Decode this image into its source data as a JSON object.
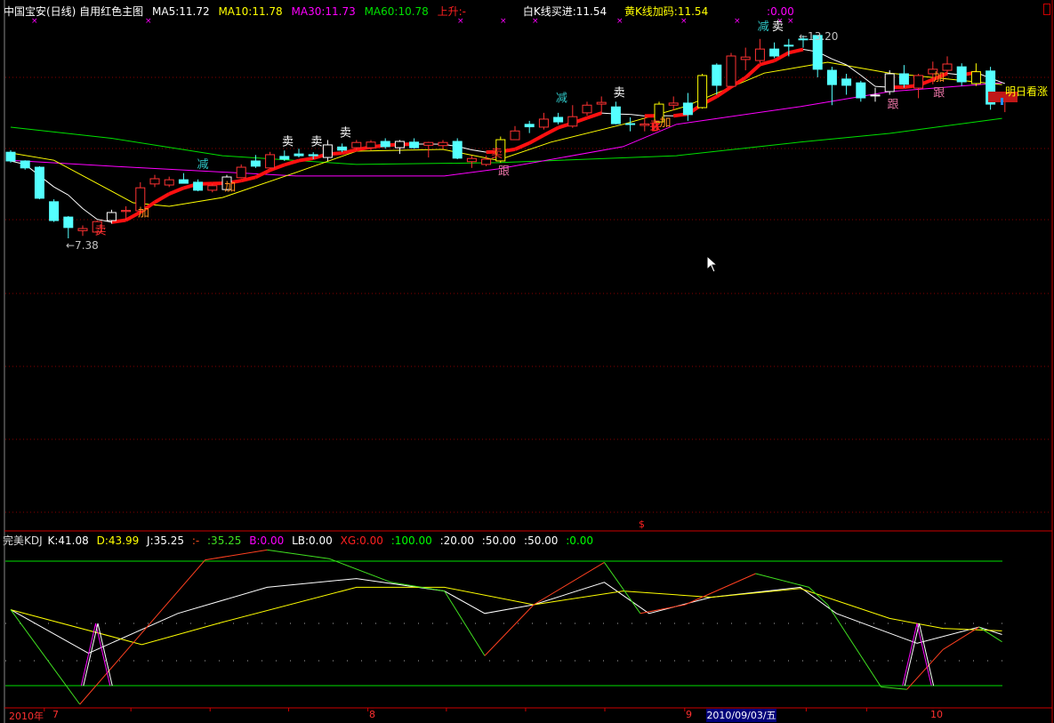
{
  "header": {
    "title": "中国宝安(日线) 自用红色主图",
    "ma5": "MA5:11.72",
    "ma10": "MA10:11.78",
    "ma30": "MA30:11.73",
    "ma60": "MA60:10.78",
    "trend": "上升:-",
    "white_buy": "白K线买进:11.54",
    "yellow_add": "黄K线加码:11.54",
    "extra": ":0.00"
  },
  "kdj_header": {
    "title": "完美KDJ",
    "k": "K:41.08",
    "d": "D:43.99",
    "j": "J:35.25",
    "dash": ":-",
    "v1": ":35.25",
    "b": "B:0.00",
    "lb": "LB:0.00",
    "xg": "XG:0.00",
    "l100": ":100.00",
    "l20": ":20.00",
    "l50a": ":50.00",
    "l50b": ":50.00",
    "l0": ":0.00"
  },
  "axis": {
    "year": "2010年",
    "m7": "7",
    "m8": "8",
    "m9": "9",
    "m10": "10",
    "cursor_date": "2010/09/03/五",
    "divider_mark": "$"
  },
  "colors": {
    "up": "#ff3232",
    "down": "#54ffff",
    "white": "#ffffff",
    "yellow": "#ffff00",
    "ma5": "#ffffff",
    "ma10": "#ffff00",
    "ma30": "#ff00ff",
    "ma60": "#00e000",
    "bg": "#000000"
  },
  "chart_data": [
    {
      "type": "candlestick",
      "title": "中国宝安(日线)",
      "ylim": [
        7.0,
        13.6
      ],
      "low_label": "←7.38",
      "high_label": "←13.20",
      "forecast_label": "明日看涨",
      "candles": [
        {
          "o": 9.85,
          "h": 9.91,
          "l": 9.55,
          "c": 9.6,
          "k": "c"
        },
        {
          "o": 9.6,
          "h": 9.62,
          "l": 9.35,
          "c": 9.4,
          "k": "c"
        },
        {
          "o": 9.42,
          "h": 9.45,
          "l": 8.5,
          "c": 8.53,
          "k": "c"
        },
        {
          "o": 8.43,
          "h": 8.5,
          "l": 7.85,
          "c": 7.89,
          "k": "c"
        },
        {
          "o": 7.99,
          "h": 8.02,
          "l": 7.38,
          "c": 7.69,
          "k": "c"
        },
        {
          "o": 7.6,
          "h": 7.75,
          "l": 7.45,
          "c": 7.66,
          "k": "r"
        },
        {
          "o": 7.56,
          "h": 7.9,
          "l": 7.5,
          "c": 7.86,
          "k": "r"
        },
        {
          "o": 7.89,
          "h": 8.2,
          "l": 7.8,
          "c": 8.12,
          "k": "w"
        },
        {
          "o": 8.15,
          "h": 8.3,
          "l": 7.9,
          "c": 8.18,
          "k": "r"
        },
        {
          "o": 8.17,
          "h": 8.99,
          "l": 8.15,
          "c": 8.83,
          "k": "r"
        },
        {
          "o": 8.94,
          "h": 9.2,
          "l": 8.85,
          "c": 9.09,
          "k": "r"
        },
        {
          "o": 8.91,
          "h": 9.15,
          "l": 8.85,
          "c": 9.06,
          "k": "r"
        },
        {
          "o": 9.06,
          "h": 9.25,
          "l": 8.95,
          "c": 8.96,
          "k": "c"
        },
        {
          "o": 8.99,
          "h": 9.07,
          "l": 8.73,
          "c": 8.76,
          "k": "c"
        },
        {
          "o": 8.76,
          "h": 8.95,
          "l": 8.7,
          "c": 8.89,
          "k": "r"
        },
        {
          "o": 8.78,
          "h": 9.2,
          "l": 8.75,
          "c": 9.14,
          "k": "w"
        },
        {
          "o": 9.12,
          "h": 9.5,
          "l": 9.1,
          "c": 9.42,
          "k": "r"
        },
        {
          "o": 9.6,
          "h": 9.77,
          "l": 9.4,
          "c": 9.45,
          "k": "c"
        },
        {
          "o": 9.4,
          "h": 9.86,
          "l": 9.38,
          "c": 9.78,
          "k": "r"
        },
        {
          "o": 9.73,
          "h": 9.9,
          "l": 9.6,
          "c": 9.65,
          "k": "c"
        },
        {
          "o": 9.8,
          "h": 9.95,
          "l": 9.7,
          "c": 9.75,
          "k": "c"
        },
        {
          "o": 9.78,
          "h": 9.85,
          "l": 9.65,
          "c": 9.75,
          "k": "c"
        },
        {
          "o": 9.7,
          "h": 10.2,
          "l": 9.6,
          "c": 10.06,
          "k": "w"
        },
        {
          "o": 10.0,
          "h": 10.1,
          "l": 9.85,
          "c": 9.91,
          "k": "c"
        },
        {
          "o": 9.98,
          "h": 10.2,
          "l": 9.9,
          "c": 10.13,
          "k": "r"
        },
        {
          "o": 9.98,
          "h": 10.2,
          "l": 9.9,
          "c": 10.14,
          "k": "r"
        },
        {
          "o": 10.16,
          "h": 10.25,
          "l": 9.95,
          "c": 10.01,
          "k": "c"
        },
        {
          "o": 9.98,
          "h": 10.2,
          "l": 9.8,
          "c": 10.16,
          "k": "w"
        },
        {
          "o": 10.14,
          "h": 10.25,
          "l": 9.95,
          "c": 9.98,
          "k": "c"
        },
        {
          "o": 10.05,
          "h": 10.15,
          "l": 9.7,
          "c": 10.13,
          "k": "r"
        },
        {
          "o": 10.04,
          "h": 10.2,
          "l": 9.95,
          "c": 10.13,
          "k": "r"
        },
        {
          "o": 10.16,
          "h": 10.25,
          "l": 9.65,
          "c": 9.68,
          "k": "c"
        },
        {
          "o": 9.58,
          "h": 9.75,
          "l": 9.4,
          "c": 9.67,
          "k": "r"
        },
        {
          "o": 9.5,
          "h": 9.75,
          "l": 9.45,
          "c": 9.65,
          "k": "r"
        },
        {
          "o": 9.6,
          "h": 10.3,
          "l": 9.55,
          "c": 10.21,
          "k": "y"
        },
        {
          "o": 10.21,
          "h": 10.6,
          "l": 10.2,
          "c": 10.46,
          "k": "r"
        },
        {
          "o": 10.65,
          "h": 10.75,
          "l": 10.4,
          "c": 10.58,
          "k": "c"
        },
        {
          "o": 10.57,
          "h": 10.98,
          "l": 10.5,
          "c": 10.8,
          "k": "r"
        },
        {
          "o": 10.85,
          "h": 10.98,
          "l": 10.65,
          "c": 10.72,
          "k": "c"
        },
        {
          "o": 10.6,
          "h": 11.2,
          "l": 10.55,
          "c": 10.87,
          "k": "r"
        },
        {
          "o": 10.98,
          "h": 11.3,
          "l": 10.9,
          "c": 11.2,
          "k": "r"
        },
        {
          "o": 11.23,
          "h": 11.45,
          "l": 10.95,
          "c": 11.28,
          "k": "r"
        },
        {
          "o": 11.15,
          "h": 11.3,
          "l": 10.65,
          "c": 10.67,
          "k": "c"
        },
        {
          "o": 10.67,
          "h": 10.85,
          "l": 10.45,
          "c": 10.65,
          "k": "c"
        },
        {
          "o": 10.62,
          "h": 10.85,
          "l": 10.45,
          "c": 10.66,
          "k": "r"
        },
        {
          "o": 10.72,
          "h": 11.3,
          "l": 10.7,
          "c": 11.23,
          "k": "y"
        },
        {
          "o": 11.2,
          "h": 11.45,
          "l": 11.05,
          "c": 11.26,
          "k": "r"
        },
        {
          "o": 11.26,
          "h": 11.55,
          "l": 10.75,
          "c": 10.93,
          "k": "c"
        },
        {
          "o": 11.13,
          "h": 12.1,
          "l": 11.1,
          "c": 12.05,
          "k": "y"
        },
        {
          "o": 12.35,
          "h": 12.4,
          "l": 11.5,
          "c": 11.77,
          "k": "c"
        },
        {
          "o": 11.74,
          "h": 12.7,
          "l": 11.7,
          "c": 12.61,
          "k": "r"
        },
        {
          "o": 12.51,
          "h": 12.85,
          "l": 12.2,
          "c": 12.58,
          "k": "r"
        },
        {
          "o": 12.48,
          "h": 13.1,
          "l": 12.4,
          "c": 12.81,
          "k": "r"
        },
        {
          "o": 12.81,
          "h": 13.0,
          "l": 12.55,
          "c": 12.61,
          "k": "c"
        },
        {
          "o": 12.92,
          "h": 13.1,
          "l": 12.6,
          "c": 12.91,
          "k": "c"
        },
        {
          "o": 13.1,
          "h": 13.2,
          "l": 12.85,
          "c": 13.09,
          "k": "c"
        },
        {
          "o": 13.2,
          "h": 13.2,
          "l": 12.0,
          "c": 12.23,
          "k": "c"
        },
        {
          "o": 12.2,
          "h": 12.3,
          "l": 11.2,
          "c": 11.79,
          "k": "c"
        },
        {
          "o": 11.95,
          "h": 12.1,
          "l": 11.5,
          "c": 11.77,
          "k": "c"
        },
        {
          "o": 11.84,
          "h": 11.9,
          "l": 11.3,
          "c": 11.41,
          "k": "c"
        },
        {
          "o": 11.48,
          "h": 11.7,
          "l": 11.3,
          "c": 11.49,
          "k": "w"
        },
        {
          "o": 11.59,
          "h": 12.2,
          "l": 11.5,
          "c": 12.1,
          "k": "w"
        },
        {
          "o": 12.1,
          "h": 12.35,
          "l": 11.7,
          "c": 11.8,
          "k": "c"
        },
        {
          "o": 11.69,
          "h": 12.1,
          "l": 11.4,
          "c": 12.05,
          "k": "r"
        },
        {
          "o": 12.1,
          "h": 12.45,
          "l": 11.8,
          "c": 12.23,
          "k": "r"
        },
        {
          "o": 12.2,
          "h": 12.6,
          "l": 12.05,
          "c": 12.38,
          "k": "r"
        },
        {
          "o": 12.3,
          "h": 12.4,
          "l": 11.75,
          "c": 11.87,
          "k": "c"
        },
        {
          "o": 11.82,
          "h": 12.4,
          "l": 11.75,
          "c": 12.16,
          "k": "y"
        },
        {
          "o": 12.18,
          "h": 12.3,
          "l": 11.07,
          "c": 11.23,
          "k": "c"
        },
        {
          "o": 11.3,
          "h": 11.5,
          "l": 11.0,
          "c": 11.46,
          "k": "r"
        }
      ],
      "ma10_points": [
        [
          0,
          9.83
        ],
        [
          3,
          9.62
        ],
        [
          8.5,
          8.4
        ],
        [
          11,
          8.3
        ],
        [
          14.7,
          8.55
        ],
        [
          19.6,
          9.24
        ],
        [
          24,
          9.88
        ],
        [
          30,
          9.93
        ],
        [
          33.8,
          9.62
        ],
        [
          37.5,
          10.14
        ],
        [
          42.5,
          10.65
        ],
        [
          46.8,
          11.16
        ],
        [
          52.3,
          12.12
        ],
        [
          56.7,
          12.43
        ],
        [
          61,
          12.12
        ],
        [
          68.8,
          11.79
        ]
      ],
      "ma30_points": [
        [
          0,
          9.62
        ],
        [
          7,
          9.45
        ],
        [
          19.8,
          9.17
        ],
        [
          30.1,
          9.17
        ],
        [
          33.8,
          9.37
        ],
        [
          42.5,
          10.01
        ],
        [
          46.2,
          10.65
        ],
        [
          54.8,
          11.16
        ],
        [
          61,
          11.59
        ],
        [
          68.8,
          11.84
        ]
      ],
      "ma60_points": [
        [
          0,
          10.57
        ],
        [
          7,
          10.25
        ],
        [
          14.7,
          9.75
        ],
        [
          24,
          9.5
        ],
        [
          33.8,
          9.55
        ],
        [
          46.2,
          9.75
        ],
        [
          54.8,
          10.14
        ],
        [
          61,
          10.39
        ],
        [
          68.8,
          10.82
        ]
      ],
      "annotations": [
        {
          "text": "卖",
          "i": 19.2,
          "p": 10.05,
          "color": "#ffffff"
        },
        {
          "text": "卖",
          "i": 21.2,
          "p": 10.05,
          "color": "#ffffff"
        },
        {
          "text": "卖",
          "i": 23.2,
          "p": 10.3,
          "color": "#ffffff"
        },
        {
          "text": "卖",
          "i": 42.2,
          "p": 11.45,
          "color": "#ffffff"
        },
        {
          "text": "卖",
          "i": 53.2,
          "p": 13.35,
          "color": "#ffffff"
        },
        {
          "text": "减",
          "i": 13.3,
          "p": 9.4,
          "color": "#30c8c8"
        },
        {
          "text": "减",
          "i": 38.2,
          "p": 11.3,
          "color": "#30c8c8"
        },
        {
          "text": "减",
          "i": 52.2,
          "p": 13.35,
          "color": "#30c8c8"
        },
        {
          "text": "加",
          "i": 9.2,
          "p": 8.0,
          "color": "#ff9020"
        },
        {
          "text": "加",
          "i": 15.2,
          "p": 8.75,
          "color": "#ff9020"
        },
        {
          "text": "加",
          "i": 45.4,
          "p": 10.6,
          "color": "#ff9020"
        },
        {
          "text": "加",
          "i": 64.4,
          "p": 11.9,
          "color": "#ff9020"
        },
        {
          "text": "卖",
          "i": 6.2,
          "p": 7.5,
          "color": "#ff3030"
        },
        {
          "text": "卖",
          "i": 33.7,
          "p": 9.7,
          "color": "#ff3030"
        },
        {
          "text": "卖",
          "i": 44.7,
          "p": 10.5,
          "color": "#ff3030"
        },
        {
          "text": "跟",
          "i": 34.2,
          "p": 9.2,
          "color": "#e070a0"
        },
        {
          "text": "跟",
          "i": 61.2,
          "p": 11.12,
          "color": "#e070a0"
        },
        {
          "text": "跟",
          "i": 64.4,
          "p": 11.45,
          "color": "#e070a0"
        },
        {
          "text": "B",
          "i": 44.8,
          "p": 10.45,
          "color": "#ff2020"
        }
      ]
    },
    {
      "type": "line",
      "title": "完美KDJ",
      "ylim": [
        -20,
        120
      ],
      "reference_lines": [
        100,
        50,
        20,
        0
      ],
      "series": [
        {
          "name": "K",
          "color": "#ffffff",
          "points": [
            [
              0,
              61
            ],
            [
              5.4,
              26
            ],
            [
              11.6,
              58
            ],
            [
              17.8,
              79
            ],
            [
              24,
              86
            ],
            [
              30.1,
              76
            ],
            [
              32.9,
              58
            ],
            [
              36.3,
              65
            ],
            [
              41.2,
              83
            ],
            [
              44.3,
              58
            ],
            [
              48.6,
              71
            ],
            [
              54.8,
              79
            ],
            [
              57.3,
              58
            ],
            [
              62.9,
              34
            ],
            [
              67.2,
              47
            ],
            [
              68.8,
              41.08
            ]
          ]
        },
        {
          "name": "D",
          "color": "#ffff00",
          "points": [
            [
              0,
              61
            ],
            [
              9.1,
              33
            ],
            [
              14.7,
              51
            ],
            [
              24,
              79
            ],
            [
              30.1,
              79
            ],
            [
              36.3,
              65
            ],
            [
              42.5,
              76
            ],
            [
              48.6,
              71
            ],
            [
              54.8,
              78
            ],
            [
              61,
              54
            ],
            [
              64.7,
              46
            ],
            [
              68.8,
              43.99
            ]
          ]
        },
        {
          "name": "J",
          "color": "#40e020",
          "points": [
            [
              0,
              61
            ],
            [
              4.8,
              -15
            ],
            [
              13.5,
              101
            ],
            [
              17.8,
              109
            ],
            [
              22.1,
              102
            ],
            [
              26.4,
              83
            ],
            [
              30.1,
              76
            ],
            [
              32.9,
              24
            ],
            [
              36.3,
              65
            ],
            [
              41.2,
              99
            ],
            [
              43.7,
              58
            ],
            [
              46.8,
              65
            ],
            [
              51.7,
              90
            ],
            [
              55.4,
              79
            ],
            [
              56.7,
              65
            ],
            [
              60.4,
              -1
            ],
            [
              62.2,
              -3
            ],
            [
              64.7,
              29
            ],
            [
              67.2,
              47
            ],
            [
              68.8,
              35.25
            ]
          ]
        },
        {
          "name": "B",
          "color": "#ff00ff",
          "points": [
            [
              4.9,
              0
            ],
            [
              5.9,
              50
            ],
            [
              6.9,
              0
            ],
            [
              61.9,
              0
            ],
            [
              62.9,
              50
            ],
            [
              63.9,
              0
            ]
          ]
        }
      ]
    }
  ]
}
